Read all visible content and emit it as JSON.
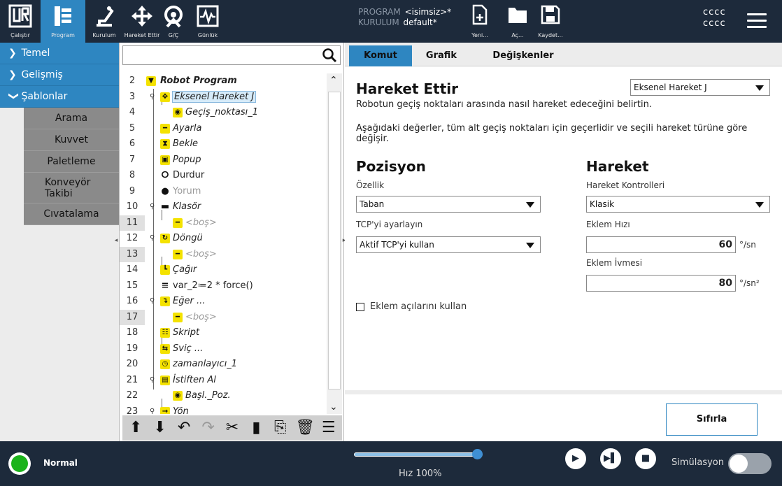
{
  "topbar": {
    "buttons": [
      {
        "label": "Çalıştır",
        "icon": "ur-logo-icon"
      },
      {
        "label": "Program",
        "icon": "program-icon"
      },
      {
        "label": "Kurulum",
        "icon": "robot-arm-icon"
      },
      {
        "label": "Hareket Ettir",
        "icon": "move-arrows-icon"
      },
      {
        "label": "G/Ç",
        "icon": "io-icon"
      },
      {
        "label": "Günlük",
        "icon": "log-icon"
      }
    ],
    "program_key": "PROGRAM",
    "program_value": "<isimsiz>*",
    "install_key": "KURULUM",
    "install_value": "default*",
    "file_buttons": [
      {
        "label": "Yeni...",
        "icon": "new-file-icon"
      },
      {
        "label": "Aç...",
        "icon": "folder-icon"
      },
      {
        "label": "Kaydet...",
        "icon": "save-icon"
      }
    ],
    "user_line1": "cccc",
    "user_line2": "cccc"
  },
  "leftnav": {
    "groups": [
      "Temel",
      "Gelişmiş",
      "Şablonlar"
    ],
    "templates": [
      "Arama",
      "Kuvvet",
      "Paletleme",
      "Konveyör Takibi",
      "Cıvatalama"
    ]
  },
  "tree": {
    "search_placeholder": "",
    "rows": [
      {
        "num": "2",
        "label": "Robot Program"
      },
      {
        "num": "3",
        "label": "Eksenel Hareket J"
      },
      {
        "num": "4",
        "label": "Geçiş_noktası_1"
      },
      {
        "num": "5",
        "label": "Ayarla"
      },
      {
        "num": "6",
        "label": "Bekle"
      },
      {
        "num": "7",
        "label": "Popup"
      },
      {
        "num": "8",
        "label": "Durdur"
      },
      {
        "num": "9",
        "label": "Yorum"
      },
      {
        "num": "10",
        "label": "Klasör"
      },
      {
        "num": "11",
        "label": "<boş>"
      },
      {
        "num": "12",
        "label": "Döngü"
      },
      {
        "num": "13",
        "label": "<boş>"
      },
      {
        "num": "14",
        "label": "Çağır"
      },
      {
        "num": "15",
        "label": "var_2≔2 * force()"
      },
      {
        "num": "16",
        "label": "Eğer ..."
      },
      {
        "num": "17",
        "label": "<boş>"
      },
      {
        "num": "18",
        "label": "Skript"
      },
      {
        "num": "19",
        "label": "Sviç ..."
      },
      {
        "num": "20",
        "label": "zamanlayıcı_1"
      },
      {
        "num": "21",
        "label": "İstiften Al"
      },
      {
        "num": "22",
        "label": "Başl._Poz."
      },
      {
        "num": "23",
        "label": "Yön"
      }
    ]
  },
  "tabs": [
    "Komut",
    "Grafik",
    "Değişkenler"
  ],
  "command": {
    "title": "Hareket Ettir",
    "move_type": "Eksenel Hareket J",
    "desc1": "Robotun geçiş noktaları arasında nasıl hareket edeceğini belirtin.",
    "desc2": "Aşağıdaki değerler, tüm alt geçiş noktaları için geçerlidir ve seçili hareket türüne göre değişir.",
    "position_title": "Pozisyon",
    "feature_label": "Özellik",
    "feature_value": "Taban",
    "tcp_label": "TCP'yi ayarlayın",
    "tcp_value": "Aktif TCP'yi kullan",
    "motion_title": "Hareket",
    "controller_label": "Hareket Kontrolleri",
    "controller_value": "Klasik",
    "speed_label": "Eklem Hızı",
    "speed_value": "60",
    "speed_unit": "°/sn",
    "accel_label": "Eklem İvmesi",
    "accel_value": "80",
    "accel_unit": "°/sn²",
    "joint_angles_label": "Eklem açılarını kullan",
    "reset_label": "Sıfırla"
  },
  "footer": {
    "status": "Normal",
    "speed_label": "Hız 100%",
    "speed_fraction": 1.0,
    "sim_label": "Simülasyon"
  }
}
